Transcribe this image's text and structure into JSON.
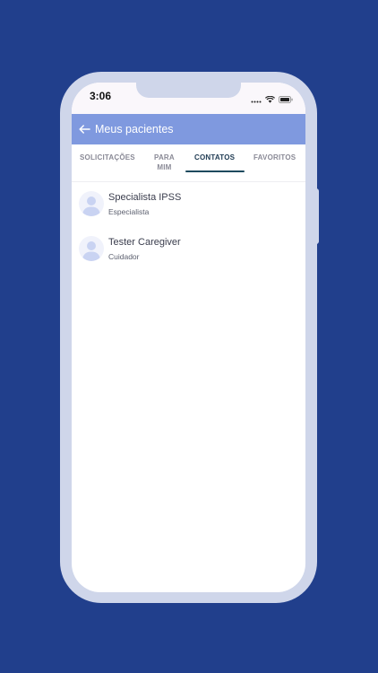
{
  "status_bar": {
    "time": "3:06"
  },
  "appbar": {
    "title": "Meus pacientes"
  },
  "tabs": [
    {
      "label": "SOLICITAÇÕES"
    },
    {
      "label_line1": "PARA",
      "label_line2": "MIM"
    },
    {
      "label": "CONTATOS",
      "active": true
    },
    {
      "label": "FAVORITOS"
    }
  ],
  "contacts": [
    {
      "name": "Specialista IPSS",
      "role": "Especialista"
    },
    {
      "name": "Tester Caregiver",
      "role": "Cuidador"
    }
  ],
  "colors": {
    "background": "#213f8c",
    "phone_frame": "#cfd6ea",
    "appbar": "#7f99df",
    "active_tab": "#1e3a52"
  },
  "icons": [
    "back-arrow-icon",
    "signal-icon",
    "wifi-icon",
    "battery-icon",
    "user-avatar-icon"
  ]
}
